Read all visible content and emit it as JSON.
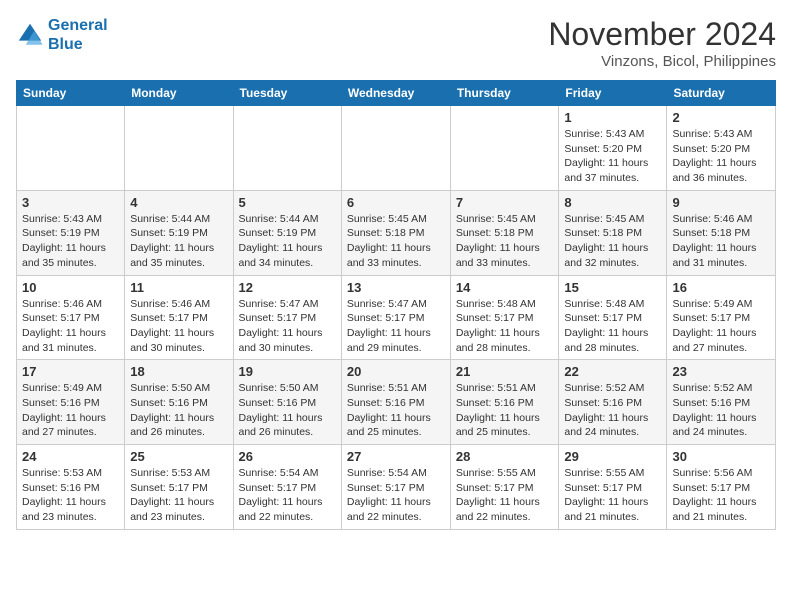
{
  "logo": {
    "line1": "General",
    "line2": "Blue"
  },
  "title": "November 2024",
  "subtitle": "Vinzons, Bicol, Philippines",
  "weekdays": [
    "Sunday",
    "Monday",
    "Tuesday",
    "Wednesday",
    "Thursday",
    "Friday",
    "Saturday"
  ],
  "weeks": [
    [
      {
        "day": "",
        "info": ""
      },
      {
        "day": "",
        "info": ""
      },
      {
        "day": "",
        "info": ""
      },
      {
        "day": "",
        "info": ""
      },
      {
        "day": "",
        "info": ""
      },
      {
        "day": "1",
        "info": "Sunrise: 5:43 AM\nSunset: 5:20 PM\nDaylight: 11 hours\nand 37 minutes."
      },
      {
        "day": "2",
        "info": "Sunrise: 5:43 AM\nSunset: 5:20 PM\nDaylight: 11 hours\nand 36 minutes."
      }
    ],
    [
      {
        "day": "3",
        "info": "Sunrise: 5:43 AM\nSunset: 5:19 PM\nDaylight: 11 hours\nand 35 minutes."
      },
      {
        "day": "4",
        "info": "Sunrise: 5:44 AM\nSunset: 5:19 PM\nDaylight: 11 hours\nand 35 minutes."
      },
      {
        "day": "5",
        "info": "Sunrise: 5:44 AM\nSunset: 5:19 PM\nDaylight: 11 hours\nand 34 minutes."
      },
      {
        "day": "6",
        "info": "Sunrise: 5:45 AM\nSunset: 5:18 PM\nDaylight: 11 hours\nand 33 minutes."
      },
      {
        "day": "7",
        "info": "Sunrise: 5:45 AM\nSunset: 5:18 PM\nDaylight: 11 hours\nand 33 minutes."
      },
      {
        "day": "8",
        "info": "Sunrise: 5:45 AM\nSunset: 5:18 PM\nDaylight: 11 hours\nand 32 minutes."
      },
      {
        "day": "9",
        "info": "Sunrise: 5:46 AM\nSunset: 5:18 PM\nDaylight: 11 hours\nand 31 minutes."
      }
    ],
    [
      {
        "day": "10",
        "info": "Sunrise: 5:46 AM\nSunset: 5:17 PM\nDaylight: 11 hours\nand 31 minutes."
      },
      {
        "day": "11",
        "info": "Sunrise: 5:46 AM\nSunset: 5:17 PM\nDaylight: 11 hours\nand 30 minutes."
      },
      {
        "day": "12",
        "info": "Sunrise: 5:47 AM\nSunset: 5:17 PM\nDaylight: 11 hours\nand 30 minutes."
      },
      {
        "day": "13",
        "info": "Sunrise: 5:47 AM\nSunset: 5:17 PM\nDaylight: 11 hours\nand 29 minutes."
      },
      {
        "day": "14",
        "info": "Sunrise: 5:48 AM\nSunset: 5:17 PM\nDaylight: 11 hours\nand 28 minutes."
      },
      {
        "day": "15",
        "info": "Sunrise: 5:48 AM\nSunset: 5:17 PM\nDaylight: 11 hours\nand 28 minutes."
      },
      {
        "day": "16",
        "info": "Sunrise: 5:49 AM\nSunset: 5:17 PM\nDaylight: 11 hours\nand 27 minutes."
      }
    ],
    [
      {
        "day": "17",
        "info": "Sunrise: 5:49 AM\nSunset: 5:16 PM\nDaylight: 11 hours\nand 27 minutes."
      },
      {
        "day": "18",
        "info": "Sunrise: 5:50 AM\nSunset: 5:16 PM\nDaylight: 11 hours\nand 26 minutes."
      },
      {
        "day": "19",
        "info": "Sunrise: 5:50 AM\nSunset: 5:16 PM\nDaylight: 11 hours\nand 26 minutes."
      },
      {
        "day": "20",
        "info": "Sunrise: 5:51 AM\nSunset: 5:16 PM\nDaylight: 11 hours\nand 25 minutes."
      },
      {
        "day": "21",
        "info": "Sunrise: 5:51 AM\nSunset: 5:16 PM\nDaylight: 11 hours\nand 25 minutes."
      },
      {
        "day": "22",
        "info": "Sunrise: 5:52 AM\nSunset: 5:16 PM\nDaylight: 11 hours\nand 24 minutes."
      },
      {
        "day": "23",
        "info": "Sunrise: 5:52 AM\nSunset: 5:16 PM\nDaylight: 11 hours\nand 24 minutes."
      }
    ],
    [
      {
        "day": "24",
        "info": "Sunrise: 5:53 AM\nSunset: 5:16 PM\nDaylight: 11 hours\nand 23 minutes."
      },
      {
        "day": "25",
        "info": "Sunrise: 5:53 AM\nSunset: 5:17 PM\nDaylight: 11 hours\nand 23 minutes."
      },
      {
        "day": "26",
        "info": "Sunrise: 5:54 AM\nSunset: 5:17 PM\nDaylight: 11 hours\nand 22 minutes."
      },
      {
        "day": "27",
        "info": "Sunrise: 5:54 AM\nSunset: 5:17 PM\nDaylight: 11 hours\nand 22 minutes."
      },
      {
        "day": "28",
        "info": "Sunrise: 5:55 AM\nSunset: 5:17 PM\nDaylight: 11 hours\nand 22 minutes."
      },
      {
        "day": "29",
        "info": "Sunrise: 5:55 AM\nSunset: 5:17 PM\nDaylight: 11 hours\nand 21 minutes."
      },
      {
        "day": "30",
        "info": "Sunrise: 5:56 AM\nSunset: 5:17 PM\nDaylight: 11 hours\nand 21 minutes."
      }
    ]
  ]
}
